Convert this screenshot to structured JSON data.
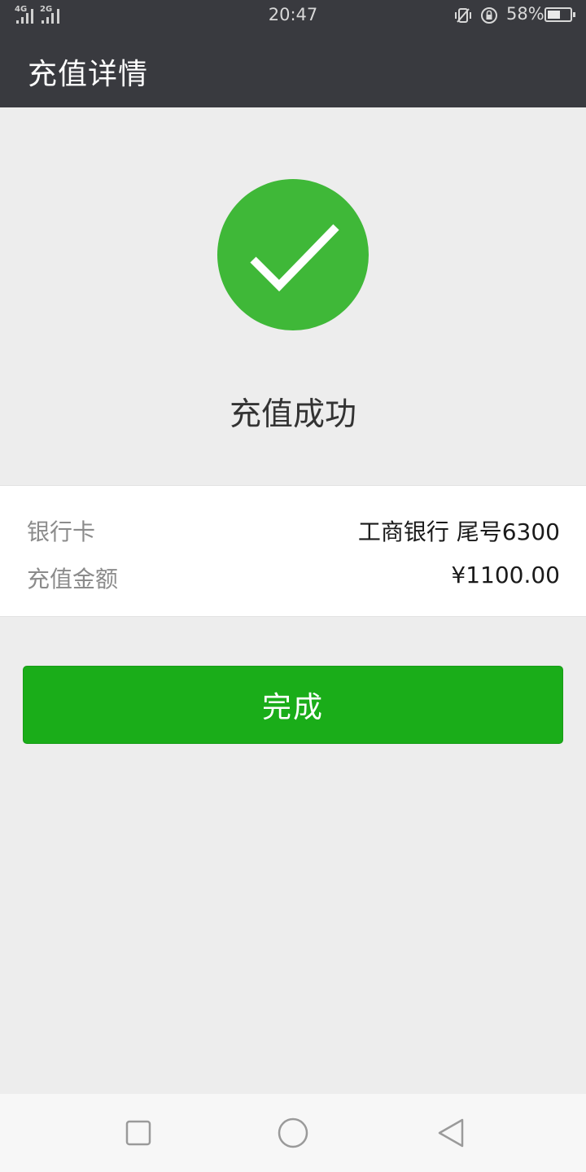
{
  "status_bar": {
    "network_1": "4G",
    "network_2": "2G",
    "time": "20:47",
    "battery_percent": "58%",
    "battery_level": 0.58,
    "icons": [
      "vibrate-icon",
      "rotation-lock-icon",
      "battery-icon"
    ]
  },
  "header": {
    "title": "充值详情",
    "background": "#393a3f"
  },
  "result": {
    "icon": "checkmark-circle-icon",
    "icon_color": "#3fb838",
    "message": "充值成功"
  },
  "details": [
    {
      "label": "银行卡",
      "value": "工商银行 尾号6300"
    },
    {
      "label": "充值金额",
      "value": "¥1100.00"
    }
  ],
  "actions": {
    "done_label": "完成",
    "done_color": "#1aad19"
  },
  "nav_bar": {
    "buttons": [
      "recent-apps-icon",
      "home-icon",
      "back-icon"
    ]
  }
}
